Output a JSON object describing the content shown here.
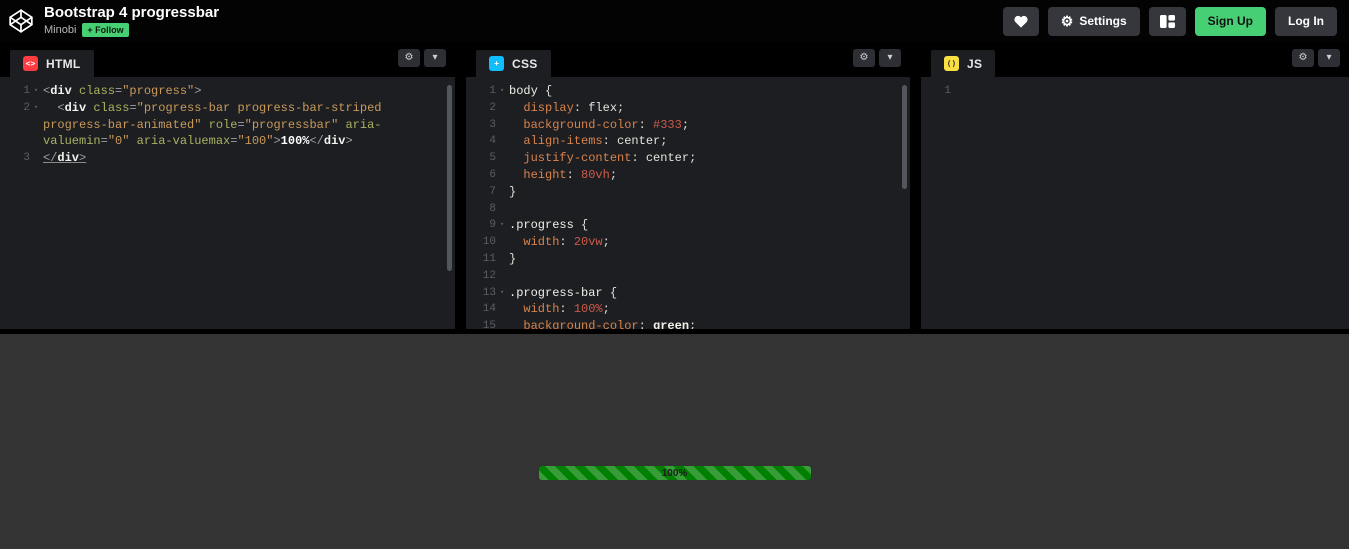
{
  "header": {
    "title": "Bootstrap 4 progressbar",
    "author": "Minobi",
    "follow_label": "+ Follow",
    "settings_label": "Settings",
    "signup_label": "Sign Up",
    "login_label": "Log In",
    "accent_green": "#47cf73",
    "like_icon": "heart-icon",
    "layout_icon": "editor-layout-icon"
  },
  "editors": [
    {
      "name": "HTML",
      "icon": {
        "bg": "#ff3c41",
        "fg": "#ffffff",
        "glyph": "<>"
      },
      "lines": [
        {
          "n": 1,
          "f": true,
          "tok": [
            [
              "pun",
              "<"
            ],
            [
              "tag",
              "div"
            ],
            [
              "pun",
              " "
            ],
            [
              "attr",
              "class"
            ],
            [
              "pun",
              "="
            ],
            [
              "str",
              "\"progress\""
            ],
            [
              "pun",
              ">"
            ]
          ]
        },
        {
          "n": 2,
          "f": true,
          "tok": [
            [
              "pun",
              "  <"
            ],
            [
              "tag",
              "div"
            ],
            [
              "pun",
              " "
            ],
            [
              "attr",
              "class"
            ],
            [
              "pun",
              "="
            ],
            [
              "str",
              "\"progress-bar progress-bar-striped progress-bar-animated\""
            ],
            [
              "pun",
              " "
            ],
            [
              "attr",
              "role"
            ],
            [
              "pun",
              "="
            ],
            [
              "str",
              "\"progressbar\""
            ],
            [
              "pun",
              " "
            ],
            [
              "attr",
              "aria-valuemin"
            ],
            [
              "pun",
              "="
            ],
            [
              "str",
              "\"0\""
            ],
            [
              "pun",
              " "
            ],
            [
              "attr",
              "aria-valuemax"
            ],
            [
              "pun",
              "="
            ],
            [
              "str",
              "\"100\""
            ],
            [
              "pun",
              ">"
            ],
            [
              "bold",
              "100%"
            ],
            [
              "pun",
              "</"
            ],
            [
              "tag",
              "div"
            ],
            [
              "pun",
              ">"
            ]
          ]
        },
        {
          "n": 3,
          "u": true,
          "tok": [
            [
              "pun",
              "</"
            ],
            [
              "tag",
              "div"
            ],
            [
              "pun",
              ">"
            ]
          ]
        }
      ],
      "scrollbar": "html"
    },
    {
      "name": "CSS",
      "icon": {
        "bg": "#0ebeff",
        "fg": "#ffffff",
        "glyph": "+"
      },
      "lines": [
        {
          "n": 1,
          "f": true,
          "tok": [
            [
              "sel",
              "body"
            ],
            [
              "brc",
              " {"
            ]
          ]
        },
        {
          "n": 2,
          "tok": [
            [
              "pun",
              "  "
            ],
            [
              "prop",
              "display"
            ],
            [
              "brc",
              ": "
            ],
            [
              "val",
              "flex"
            ],
            [
              "brc",
              ";"
            ]
          ]
        },
        {
          "n": 3,
          "tok": [
            [
              "pun",
              "  "
            ],
            [
              "prop",
              "background-color"
            ],
            [
              "brc",
              ": "
            ],
            [
              "num",
              "#333"
            ],
            [
              "brc",
              ";"
            ]
          ]
        },
        {
          "n": 4,
          "tok": [
            [
              "pun",
              "  "
            ],
            [
              "prop",
              "align-items"
            ],
            [
              "brc",
              ": "
            ],
            [
              "val",
              "center"
            ],
            [
              "brc",
              ";"
            ]
          ]
        },
        {
          "n": 5,
          "tok": [
            [
              "pun",
              "  "
            ],
            [
              "prop",
              "justify-content"
            ],
            [
              "brc",
              ": "
            ],
            [
              "val",
              "center"
            ],
            [
              "brc",
              ";"
            ]
          ]
        },
        {
          "n": 6,
          "tok": [
            [
              "pun",
              "  "
            ],
            [
              "prop",
              "height"
            ],
            [
              "brc",
              ": "
            ],
            [
              "num",
              "80vh"
            ],
            [
              "brc",
              ";"
            ]
          ]
        },
        {
          "n": 7,
          "tok": [
            [
              "brc",
              "}"
            ]
          ]
        },
        {
          "n": 8,
          "tok": []
        },
        {
          "n": 9,
          "f": true,
          "tok": [
            [
              "sel",
              ".progress"
            ],
            [
              "brc",
              " {"
            ]
          ]
        },
        {
          "n": 10,
          "tok": [
            [
              "pun",
              "  "
            ],
            [
              "prop",
              "width"
            ],
            [
              "brc",
              ": "
            ],
            [
              "num",
              "20vw"
            ],
            [
              "brc",
              ";"
            ]
          ]
        },
        {
          "n": 11,
          "tok": [
            [
              "brc",
              "}"
            ]
          ]
        },
        {
          "n": 12,
          "tok": []
        },
        {
          "n": 13,
          "f": true,
          "tok": [
            [
              "sel",
              ".progress-bar"
            ],
            [
              "brc",
              " {"
            ]
          ]
        },
        {
          "n": 14,
          "tok": [
            [
              "pun",
              "  "
            ],
            [
              "prop",
              "width"
            ],
            [
              "brc",
              ": "
            ],
            [
              "num",
              "100%"
            ],
            [
              "brc",
              ";"
            ]
          ]
        },
        {
          "n": 15,
          "tok": [
            [
              "pun",
              "  "
            ],
            [
              "prop",
              "background-color"
            ],
            [
              "brc",
              ": "
            ],
            [
              "kw",
              "green"
            ],
            [
              "brc",
              ";"
            ]
          ]
        }
      ],
      "scrollbar": "css"
    },
    {
      "name": "JS",
      "icon": {
        "bg": "#fae042",
        "fg": "#33302a",
        "glyph": "()"
      },
      "lines": [
        {
          "n": 1,
          "tok": []
        }
      ],
      "scrollbar": ""
    }
  ],
  "preview": {
    "background": "#333333",
    "progressbar": {
      "label": "100%",
      "color": "green",
      "striped": true,
      "width_hint": "20vw",
      "value": 100
    }
  }
}
